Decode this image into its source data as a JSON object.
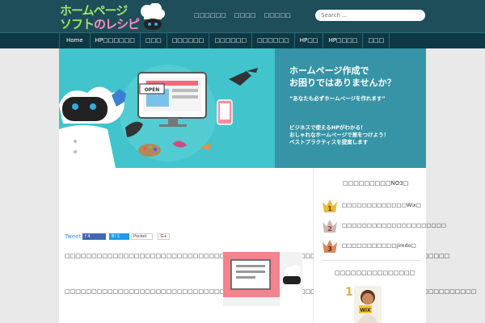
{
  "site": {
    "logo_line1": "ホームページ",
    "logo_line2a": "ソフト",
    "logo_line2b": "のレシピ"
  },
  "toplinks": [
    "□□□□□□",
    "□□□□",
    "□□□□□"
  ],
  "search": {
    "placeholder": "Search ..."
  },
  "nav": [
    "Home",
    "HP□□□□□□",
    "□□□",
    "□□□□□□",
    "□□□□□□",
    "□□□□□□",
    "HP□□",
    "HP□□□□",
    "□□□"
  ],
  "hero": {
    "headline_1": "ホームページ作成で",
    "headline_2": "お困りではありませんか？",
    "tagline": "”あなたも必ずホームページを作れます”",
    "bullet_1": "ビジネスで使えるHPがわかる！",
    "bullet_2": "おしゃれなホームページで差をつけよう！",
    "bullet_3": "ベストプラクティスを提案します",
    "open_sign": "OPEN"
  },
  "share": {
    "tweet": "Tweet",
    "fb_count": "4",
    "hatena_count": "1",
    "pocket": "Pocket",
    "gplus": "G+"
  },
  "article": {
    "para1": "□□□□□□□□□□□□□□□□□□□□□□□□□□□□□□□□□□□□□□□□□□□□□□□□□□□□□□□□□□□□□□□□□□□□□□□□",
    "para2": "□□□□□□□□□□□□□□□□□□□□□□□□□□□□□□□□□□□□□□□□□□□□□□□□□□□□□□□□□□□□□□□□□□□□□□□□□□□□□"
  },
  "sidebar": {
    "title": "□□□□□□□□□NO3□",
    "ranks": [
      {
        "num": "1",
        "label": "□□□□□□□□□□□□□Wix□",
        "color": "#e8b93a"
      },
      {
        "num": "2",
        "label": "□□□□□□□□□□□□□□□□□□□□□",
        "color": "#c9b8b0"
      },
      {
        "num": "3",
        "label": "□□□□□□□□□□□jimdo□",
        "color": "#d88a5a"
      }
    ],
    "title2": "□□□□□□□□□□□□□□□",
    "wix_rank": "1",
    "wix_label": "WiX"
  },
  "colors": {
    "header_bg": "#1d4e5a",
    "nav_bg": "#0e3944",
    "hero_bg": "#41c4cc",
    "hero_right": "#3694a6",
    "logo_green": "#9fe36a",
    "logo_pink": "#ff8dc0"
  }
}
